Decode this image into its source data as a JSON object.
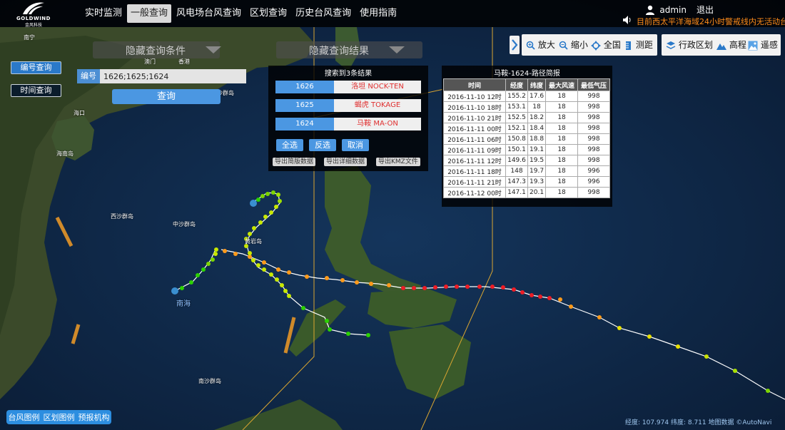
{
  "app": {
    "logo_en": "GOLDWIND",
    "logo_cn": "金风科技",
    "nav": [
      "实时监测",
      "一般查询",
      "风电场台风查询",
      "区划查询",
      "历史台风查询",
      "使用指南"
    ],
    "active_nav": "一般查询",
    "user": "admin",
    "logout": "退出",
    "warning": "目前西太平洋海域24小时警戒线内无活动台风"
  },
  "query_panel": {
    "hide_conditions": "隐藏查询条件",
    "by_number": "编号查询",
    "by_time": "时间查询",
    "number_label": "编号",
    "number_value": "1626;1625;1624",
    "query_button": "查询"
  },
  "results_panel": {
    "hide_results": "隐藏查询结果",
    "summary": "搜索到3条结果",
    "items": [
      {
        "id": "1626",
        "name": "洛坦 NOCK-TEN"
      },
      {
        "id": "1625",
        "name": "蝎虎 TOKAGE"
      },
      {
        "id": "1624",
        "name": "马鞍 MA-ON"
      }
    ],
    "select_all": "全选",
    "invert": "反选",
    "cancel": "取消",
    "export_simple": "导出简版数据",
    "export_detail": "导出详细数据",
    "export_kmz": "导出KMZ文件"
  },
  "brief": {
    "title": "马鞍-1624-路径简报",
    "headers": [
      "时间",
      "经度",
      "纬度",
      "最大风速",
      "最低气压"
    ],
    "rows": [
      [
        "2016-11-10 12时",
        "155.2",
        "17.6",
        "18",
        "998"
      ],
      [
        "2016-11-10 18时",
        "153.1",
        "18",
        "18",
        "998"
      ],
      [
        "2016-11-10 21时",
        "152.5",
        "18.2",
        "18",
        "998"
      ],
      [
        "2016-11-11 00时",
        "152.1",
        "18.4",
        "18",
        "998"
      ],
      [
        "2016-11-11 06时",
        "150.8",
        "18.8",
        "18",
        "998"
      ],
      [
        "2016-11-11 09时",
        "150.1",
        "19.1",
        "18",
        "998"
      ],
      [
        "2016-11-11 12时",
        "149.6",
        "19.5",
        "18",
        "998"
      ],
      [
        "2016-11-11 18时",
        "148",
        "19.7",
        "18",
        "996"
      ],
      [
        "2016-11-11 21时",
        "147.3",
        "19.3",
        "18",
        "996"
      ],
      [
        "2016-11-12 00时",
        "147.1",
        "20.1",
        "18",
        "998"
      ]
    ]
  },
  "toolbar": {
    "zoom_in": "放大",
    "zoom_out": "缩小",
    "full": "全国",
    "measure": "测距",
    "admin": "行政区划",
    "elevation": "高程",
    "remote": "遥感"
  },
  "bottom": {
    "legend_typhoon": "台风图例",
    "legend_zone": "区划图例",
    "legend_agency": "预报机构",
    "coord_text": "经度: 107.974 纬度: 8.711  地图数据 ©AutoNavi"
  },
  "map_labels": {
    "nanning": "南宁",
    "macau": "澳门",
    "hongkong": "香港",
    "haikou": "海口",
    "hainan": "海南岛",
    "xisha": "西沙群岛",
    "zhongsha": "中沙群岛",
    "huangyan": "黄岩岛",
    "nanhai": "南海",
    "nansha": "南沙群岛",
    "dongsha": "东沙群岛"
  }
}
